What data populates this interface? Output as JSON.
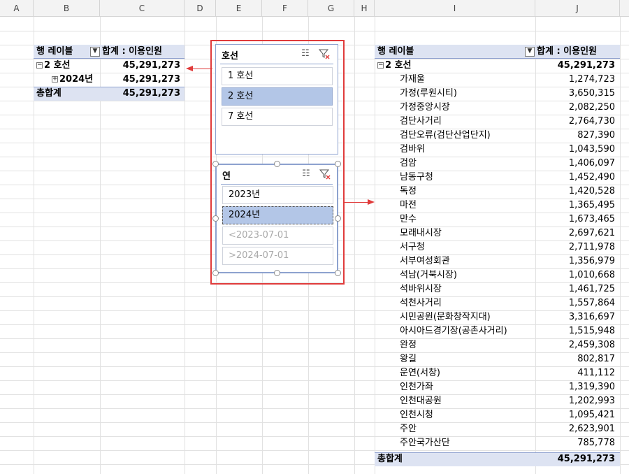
{
  "columns": [
    "A",
    "B",
    "C",
    "D",
    "E",
    "F",
    "G",
    "H",
    "I",
    "J"
  ],
  "left_pivot": {
    "row_label_header": "행 레이블",
    "sum_header": "합계 : 이용인원",
    "group_label": "2 호선",
    "group_total": "45,291,273",
    "child_label": "2024년",
    "child_total": "45,291,273",
    "grand_label": "총합계",
    "grand_total": "45,291,273"
  },
  "slicer_line": {
    "title": "호선",
    "items": [
      "1 호선",
      "2 호선",
      "7 호선"
    ],
    "selected": "2 호선"
  },
  "slicer_year": {
    "title": "연",
    "items": [
      "2023년",
      "2024년",
      "<2023-07-01",
      ">2024-07-01"
    ],
    "selected": "2024년"
  },
  "right_pivot": {
    "row_label_header": "행 레이블",
    "sum_header": "합계 : 이용인원",
    "group_label": "2 호선",
    "group_total": "45,291,273",
    "rows": [
      {
        "station": "가재울",
        "value": "1,274,723"
      },
      {
        "station": "가정(루원시티)",
        "value": "3,650,315"
      },
      {
        "station": "가정중앙시장",
        "value": "2,082,250"
      },
      {
        "station": "검단사거리",
        "value": "2,764,730"
      },
      {
        "station": "검단오류(검단산업단지)",
        "value": "827,390"
      },
      {
        "station": "검바위",
        "value": "1,043,590"
      },
      {
        "station": "검암",
        "value": "1,406,097"
      },
      {
        "station": "남동구청",
        "value": "1,452,490"
      },
      {
        "station": "독정",
        "value": "1,420,528"
      },
      {
        "station": "마전",
        "value": "1,365,495"
      },
      {
        "station": "만수",
        "value": "1,673,465"
      },
      {
        "station": "모래내시장",
        "value": "2,697,621"
      },
      {
        "station": "서구청",
        "value": "2,711,978"
      },
      {
        "station": "서부여성회관",
        "value": "1,356,979"
      },
      {
        "station": "석남(거북시장)",
        "value": "1,010,668"
      },
      {
        "station": "석바위시장",
        "value": "1,461,725"
      },
      {
        "station": "석천사거리",
        "value": "1,557,864"
      },
      {
        "station": "시민공원(문화창작지대)",
        "value": "3,316,697"
      },
      {
        "station": "아시아드경기장(공촌사거리)",
        "value": "1,515,948"
      },
      {
        "station": "완정",
        "value": "2,459,308"
      },
      {
        "station": "왕길",
        "value": "802,817"
      },
      {
        "station": "운연(서창)",
        "value": "411,112"
      },
      {
        "station": "인천가좌",
        "value": "1,319,390"
      },
      {
        "station": "인천대공원",
        "value": "1,202,993"
      },
      {
        "station": "인천시청",
        "value": "1,095,421"
      },
      {
        "station": "주안",
        "value": "2,623,901"
      },
      {
        "station": "주안국가산단",
        "value": "785,778"
      }
    ],
    "grand_label": "총합계",
    "grand_total": "45,291,273"
  },
  "colors": {
    "accent_red": "#e03b3b",
    "pivot_header": "#dde3f2",
    "slicer_selected": "#b3c6e7"
  },
  "icons": [
    "multi-select-icon",
    "clear-filter-icon",
    "filter-dropdown-icon",
    "collapse-icon",
    "expand-icon"
  ]
}
